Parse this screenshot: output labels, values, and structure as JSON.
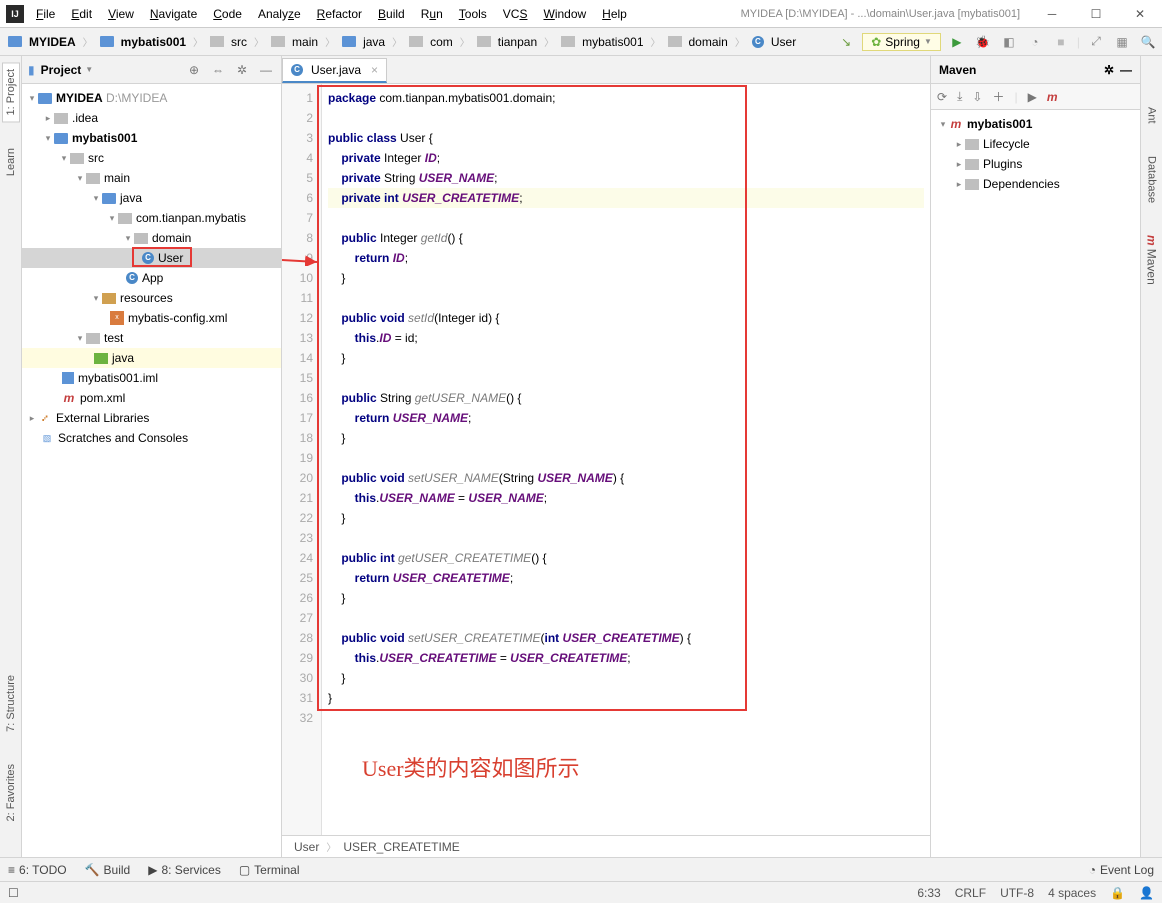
{
  "window": {
    "title": "MYIDEA [D:\\MYIDEA] - ...\\domain\\User.java [mybatis001]"
  },
  "menu": [
    "File",
    "Edit",
    "View",
    "Navigate",
    "Code",
    "Analyze",
    "Refactor",
    "Build",
    "Run",
    "Tools",
    "VCS",
    "Window",
    "Help"
  ],
  "breadcrumbs": [
    "MYIDEA",
    "mybatis001",
    "src",
    "main",
    "java",
    "com",
    "tianpan",
    "mybatis001",
    "domain",
    "User"
  ],
  "spring_label": "Spring",
  "project": {
    "title": "Project",
    "root": "MYIDEA",
    "root_path": "D:\\MYIDEA",
    "nodes": {
      "idea": ".idea",
      "mybatis001": "mybatis001",
      "src": "src",
      "main": "main",
      "java": "java",
      "pkg": "com.tianpan.mybatis",
      "domain": "domain",
      "user": "User",
      "app": "App",
      "resources": "resources",
      "mybatis_config": "mybatis-config.xml",
      "test": "test",
      "test_java": "java",
      "iml": "mybatis001.iml",
      "pom": "pom.xml",
      "ext_lib": "External Libraries",
      "scratch": "Scratches and Consoles"
    }
  },
  "tab": {
    "name": "User.java"
  },
  "code": {
    "lines": [
      "package com.tianpan.mybatis001.domain;",
      "",
      "public class User {",
      "    private Integer ID;",
      "    private String USER_NAME;",
      "    private int USER_CREATETIME;",
      "",
      "    public Integer getId() {",
      "        return ID;",
      "    }",
      "",
      "    public void setId(Integer id) {",
      "        this.ID = id;",
      "    }",
      "",
      "    public String getUSER_NAME() {",
      "        return USER_NAME;",
      "    }",
      "",
      "    public void setUSER_NAME(String USER_NAME) {",
      "        this.USER_NAME = USER_NAME;",
      "    }",
      "",
      "    public int getUSER_CREATETIME() {",
      "        return USER_CREATETIME;",
      "    }",
      "",
      "    public void setUSER_CREATETIME(int USER_CREATETIME) {",
      "        this.USER_CREATETIME = USER_CREATETIME;",
      "    }",
      "}",
      ""
    ]
  },
  "crumb_bar": {
    "a": "User",
    "b": "USER_CREATETIME"
  },
  "maven": {
    "title": "Maven",
    "root": "mybatis001",
    "lifecycle": "Lifecycle",
    "plugins": "Plugins",
    "deps": "Dependencies"
  },
  "left_tabs": {
    "project": "1: Project",
    "learn": "Learn",
    "structure": "7: Structure",
    "fav": "2: Favorites"
  },
  "right_tabs": {
    "ant": "Ant",
    "db": "Database",
    "maven": "Maven"
  },
  "bottom": {
    "todo": "6: TODO",
    "build": "Build",
    "services": "8: Services",
    "terminal": "Terminal",
    "eventlog": "Event Log"
  },
  "status": {
    "pos": "6:33",
    "crlf": "CRLF",
    "enc": "UTF-8",
    "indent": "4 spaces"
  },
  "annotation": "User类的内容如图所示"
}
